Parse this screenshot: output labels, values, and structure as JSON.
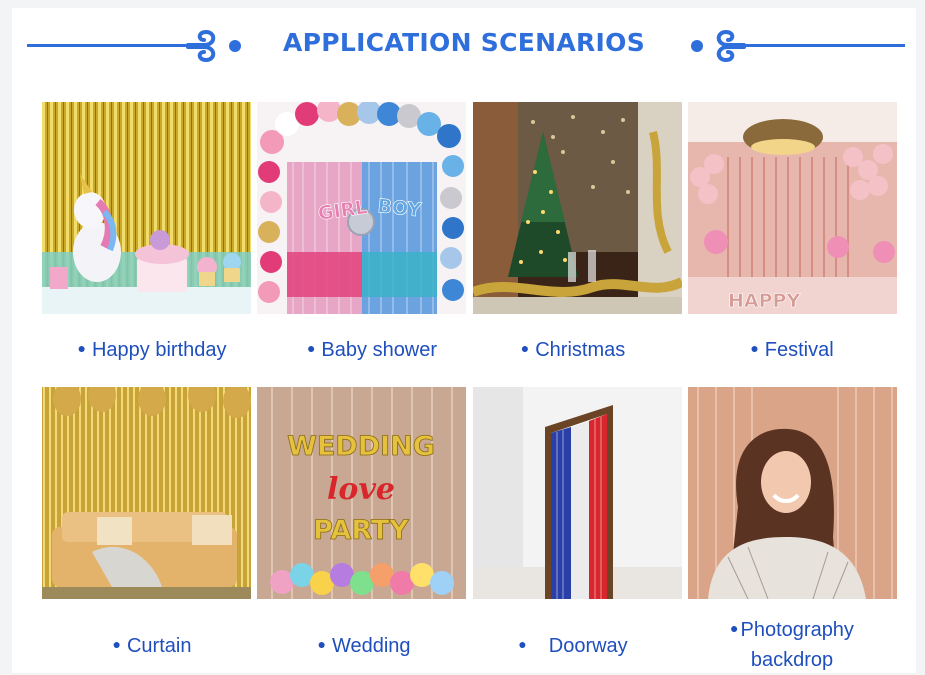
{
  "header": {
    "title": "APPLICATION SCENARIOS"
  },
  "colors": {
    "accent": "#2f6fdc",
    "caption_text": "#1f4fbd"
  },
  "scenarios": [
    {
      "label": "Happy birthday"
    },
    {
      "label": "Baby shower"
    },
    {
      "label": "Christmas"
    },
    {
      "label": "Festival"
    },
    {
      "label": "Curtain"
    },
    {
      "label": "Wedding"
    },
    {
      "label": "Doorway"
    },
    {
      "label": "Photography backdrop",
      "line1": "Photography",
      "line2": "backdrop"
    }
  ],
  "photo_text": {
    "baby_shower_girl": "GIRL",
    "baby_shower_boy": "BOY",
    "festival_banner": "HAPPY",
    "wedding_line1": "WEDDING",
    "wedding_line2": "love",
    "wedding_line3": "PARTY"
  }
}
